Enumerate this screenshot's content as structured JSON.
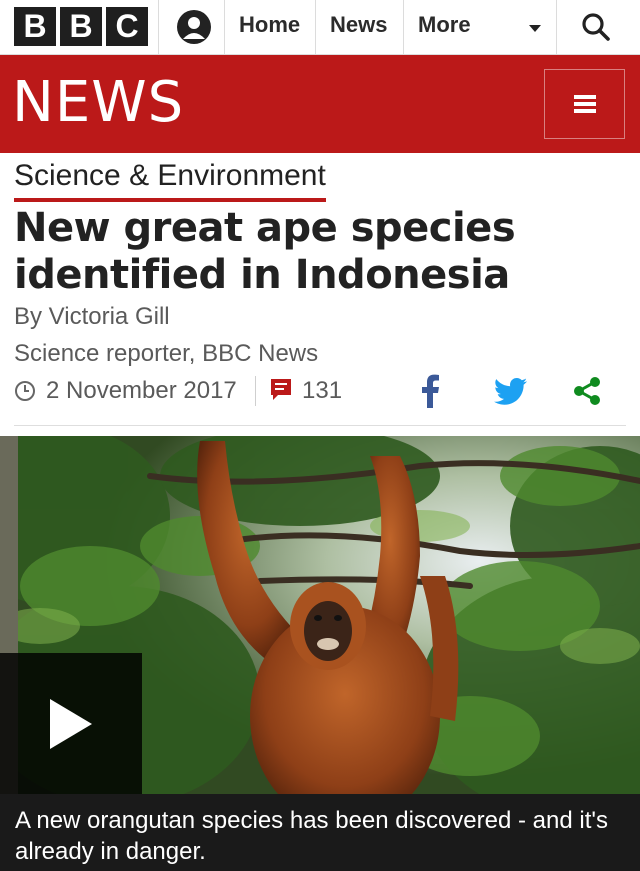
{
  "brand": {
    "logo_letters": [
      "B",
      "B",
      "C"
    ],
    "section_name": "NEWS",
    "colors": {
      "news_red": "#bb1919",
      "logo_black": "#1f1f1f",
      "facebook_blue": "#3b5998",
      "twitter_blue": "#1da1f2",
      "share_green": "#0f8b1f"
    }
  },
  "topnav": {
    "items": [
      {
        "label": "Home"
      },
      {
        "label": "News"
      },
      {
        "label": "More"
      }
    ],
    "icons": {
      "account": "account-icon",
      "more": "caret-down-icon",
      "search": "search-icon",
      "menu": "hamburger-menu-icon"
    }
  },
  "article": {
    "section": "Science & Environment",
    "headline_line1": "New great ape species",
    "headline_line2": "identified in Indonesia",
    "byline": "By Victoria Gill",
    "role": "Science reporter, BBC News",
    "date": "2 November 2017",
    "comment_count": "131",
    "share": [
      "facebook-icon",
      "twitter-icon",
      "share-icon"
    ]
  },
  "media": {
    "caption": "A new orangutan species has been discovered - and it's already in danger.",
    "play_icon": "play-icon"
  }
}
